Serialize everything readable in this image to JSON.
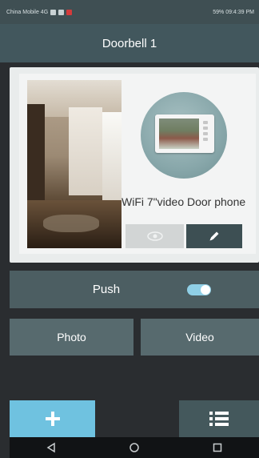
{
  "status_bar": {
    "carrier": "China Mobile 4G",
    "battery_time": "59% 09:4:39 PM"
  },
  "header": {
    "title": "Doorbell  1"
  },
  "device_card": {
    "name": "WiFi 7\"video Door phone"
  },
  "push": {
    "label": "Push",
    "enabled": true
  },
  "actions": {
    "photo_label": "Photo",
    "video_label": "Video"
  },
  "icons": {
    "preview": "eye-icon",
    "edit": "pencil-icon",
    "add": "plus-icon",
    "menu": "list-icon",
    "back": "back-triangle-icon",
    "home": "home-circle-icon",
    "recents": "recents-square-icon"
  },
  "colors": {
    "header_bg": "#42575d",
    "accent": "#6fc2e0",
    "button_bg": "#576a6e"
  }
}
